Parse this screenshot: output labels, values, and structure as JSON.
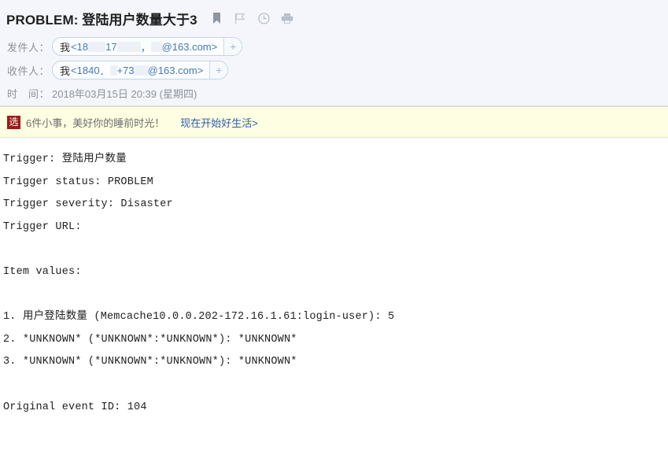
{
  "header": {
    "title": "PROBLEM: 登陆用户数量大于3",
    "icons": [
      {
        "name": "bookmark-icon",
        "label": "bookmark"
      },
      {
        "name": "flag-icon",
        "label": "flag"
      },
      {
        "name": "clock-icon",
        "label": "clock"
      },
      {
        "name": "print-icon",
        "label": "print"
      }
    ],
    "sender": {
      "label": "发件人：",
      "me": "我",
      "open_bracket": "<",
      "part1": "18",
      "part2": "17",
      "part3": "，",
      "domain": "@163.com",
      "close_bracket": ">",
      "add_label": "+"
    },
    "recipient": {
      "label": "收件人：",
      "me": "我",
      "open_bracket": "<",
      "part1": "1840",
      "part2": "．",
      "part3": "+73",
      "domain": "@163.com",
      "close_bracket": ">",
      "add_label": "+"
    },
    "date": {
      "label": "时　间：",
      "value": "2018年03月15日 20:39 (星期四)"
    }
  },
  "ad_banner": {
    "badge": "选",
    "text": "6件小事，美好你的睡前时光！",
    "link": "现在开始好生活>"
  },
  "body": {
    "lines": [
      "Trigger: 登陆用户数量",
      "Trigger status: PROBLEM",
      "Trigger severity: Disaster",
      "Trigger URL:",
      "",
      "Item values:",
      ""
    ],
    "items": [
      "1. 用户登陆数量 (Memcache10.0.0.202-172.16.1.61:login-user): 5",
      "2. *UNKNOWN* (*UNKNOWN*:*UNKNOWN*): *UNKNOWN*",
      "3. *UNKNOWN* (*UNKNOWN*:*UNKNOWN*): *UNKNOWN*"
    ],
    "trailing_lines": [
      "",
      "Original event ID: 104"
    ]
  },
  "colors": {
    "header_bg": "#f4f6fb",
    "banner_bg": "#fefee2",
    "badge_red": "#9e1b1b",
    "link_blue": "#2b5fa8",
    "chip_blue": "#4a77b4",
    "label_gray": "#8d929b"
  }
}
